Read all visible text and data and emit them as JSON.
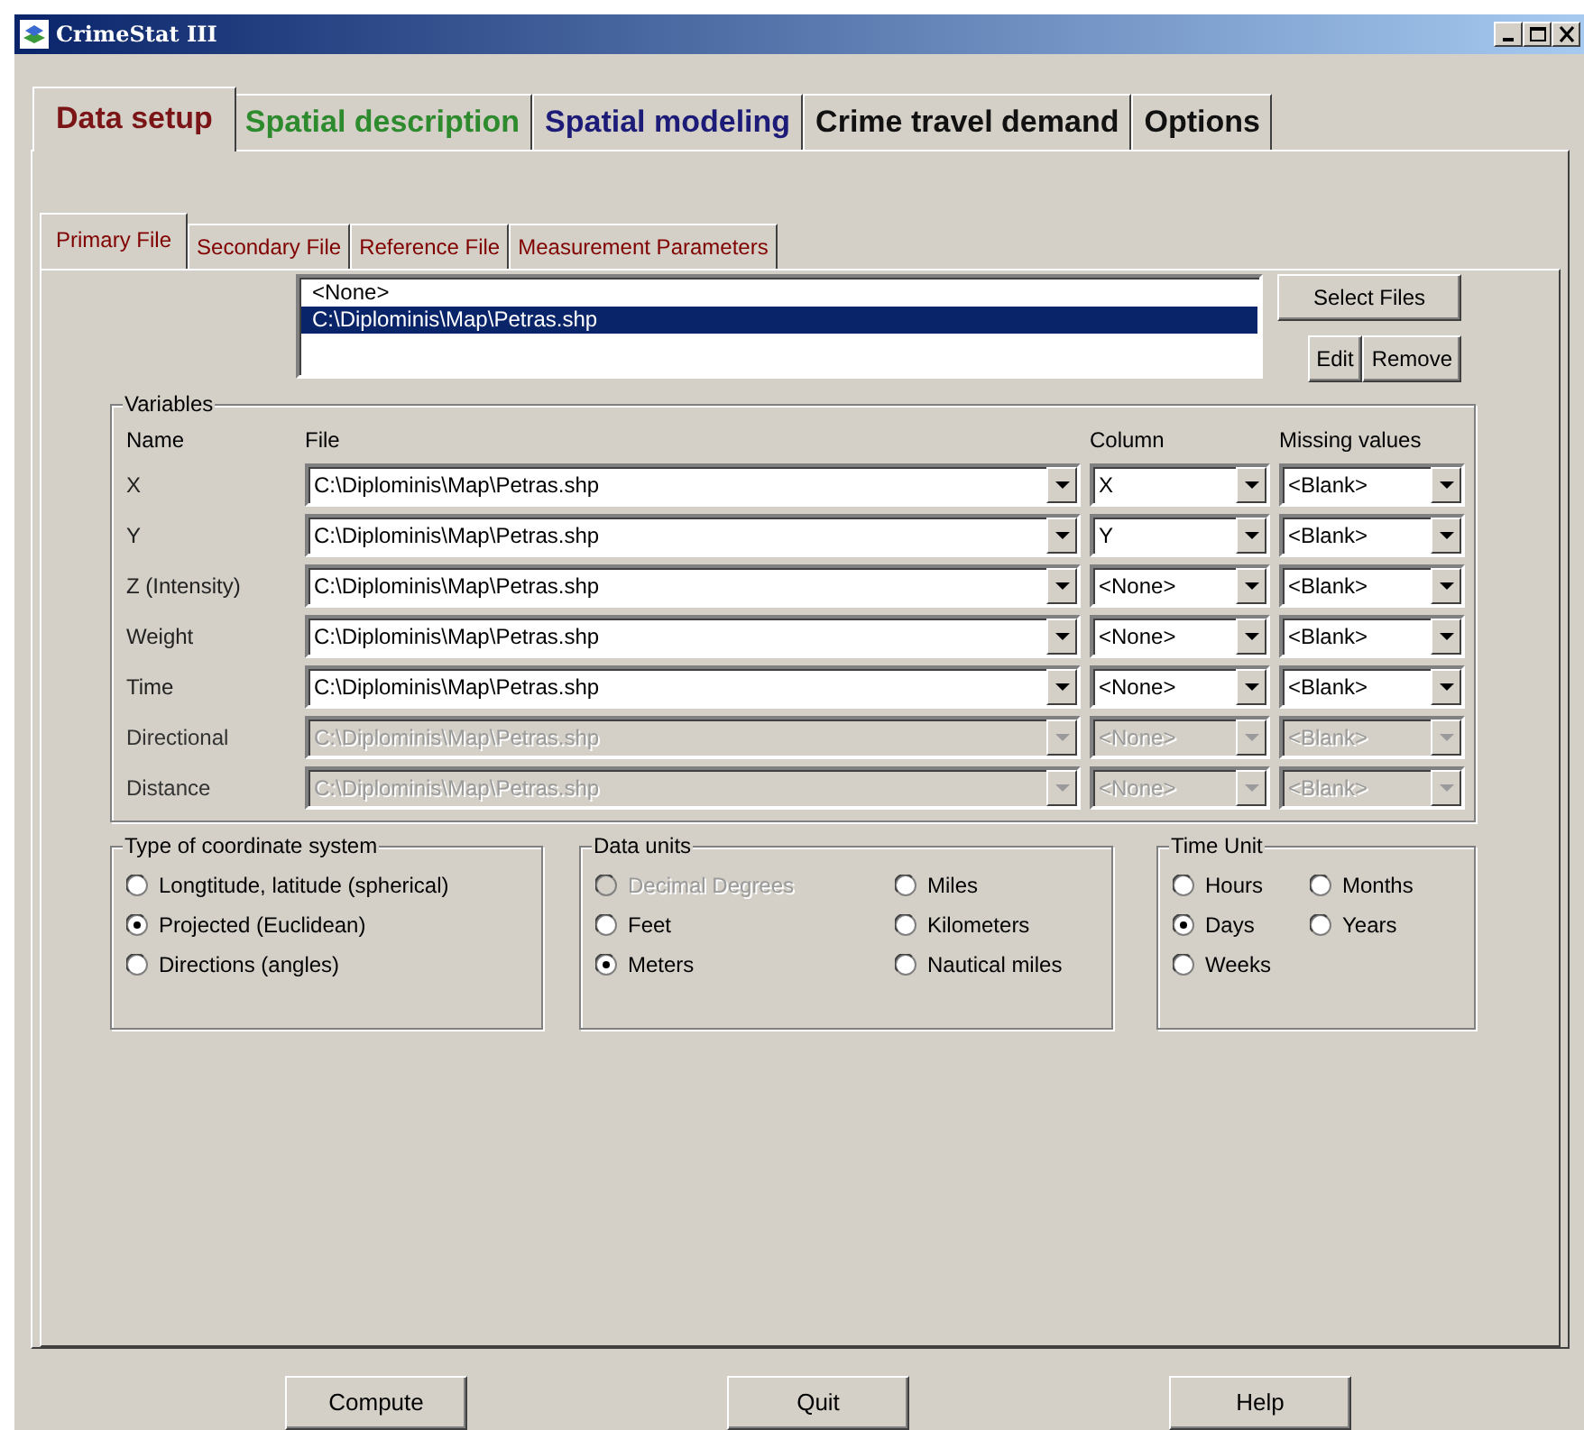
{
  "window": {
    "title": "CrimeStat III"
  },
  "main_tabs": [
    {
      "label": "Data setup",
      "selected": true,
      "color": "#7a1416"
    },
    {
      "label": "Spatial description",
      "selected": false,
      "color": "#2d8a2d"
    },
    {
      "label": "Spatial modeling",
      "selected": false,
      "color": "#1c1c78"
    },
    {
      "label": "Crime travel demand",
      "selected": false,
      "color": "#111111"
    },
    {
      "label": "Options",
      "selected": false,
      "color": "#111111"
    }
  ],
  "sub_tabs": [
    {
      "label": "Primary File",
      "selected": true
    },
    {
      "label": "Secondary File",
      "selected": false
    },
    {
      "label": "Reference File",
      "selected": false
    },
    {
      "label": "Measurement Parameters",
      "selected": false
    }
  ],
  "files": {
    "items": [
      {
        "text": "<None>",
        "selected": false
      },
      {
        "text": "C:\\Diplominis\\Map\\Petras.shp",
        "selected": true
      }
    ],
    "select_button": "Select Files",
    "edit_button": "Edit",
    "remove_button": "Remove"
  },
  "variables": {
    "title": "Variables",
    "headers": [
      "Name",
      "File",
      "Column",
      "Missing values"
    ],
    "rows": [
      {
        "name": "X",
        "file": "C:\\Diplominis\\Map\\Petras.shp",
        "column": "X",
        "missing": "<Blank>",
        "disabled": false
      },
      {
        "name": "Y",
        "file": "C:\\Diplominis\\Map\\Petras.shp",
        "column": "Y",
        "missing": "<Blank>",
        "disabled": false
      },
      {
        "name": "Z (Intensity)",
        "file": "C:\\Diplominis\\Map\\Petras.shp",
        "column": "<None>",
        "missing": "<Blank>",
        "disabled": false
      },
      {
        "name": "Weight",
        "file": "C:\\Diplominis\\Map\\Petras.shp",
        "column": "<None>",
        "missing": "<Blank>",
        "disabled": false
      },
      {
        "name": "Time",
        "file": "C:\\Diplominis\\Map\\Petras.shp",
        "column": "<None>",
        "missing": "<Blank>",
        "disabled": false
      },
      {
        "name": "Directional",
        "file": "C:\\Diplominis\\Map\\Petras.shp",
        "column": "<None>",
        "missing": "<Blank>",
        "disabled": true
      },
      {
        "name": "Distance",
        "file": "C:\\Diplominis\\Map\\Petras.shp",
        "column": "<None>",
        "missing": "<Blank>",
        "disabled": true
      }
    ]
  },
  "coordinate_system": {
    "title": "Type of coordinate system",
    "options": [
      {
        "label": "Longtitude, latitude (spherical)",
        "selected": false,
        "disabled": false
      },
      {
        "label": "Projected (Euclidean)",
        "selected": true,
        "disabled": false
      },
      {
        "label": "Directions (angles)",
        "selected": false,
        "disabled": false
      }
    ]
  },
  "data_units": {
    "title": "Data units",
    "options": [
      {
        "label": "Decimal Degrees",
        "selected": false,
        "disabled": true
      },
      {
        "label": "Miles",
        "selected": false,
        "disabled": false
      },
      {
        "label": "Feet",
        "selected": false,
        "disabled": false
      },
      {
        "label": "Kilometers",
        "selected": false,
        "disabled": false
      },
      {
        "label": "Meters",
        "selected": true,
        "disabled": false
      },
      {
        "label": "Nautical miles",
        "selected": false,
        "disabled": false
      }
    ]
  },
  "time_unit": {
    "title": "Time Unit",
    "options": [
      {
        "label": "Hours",
        "selected": false,
        "disabled": false
      },
      {
        "label": "Months",
        "selected": false,
        "disabled": false
      },
      {
        "label": "Days",
        "selected": true,
        "disabled": false
      },
      {
        "label": "Years",
        "selected": false,
        "disabled": false
      },
      {
        "label": "Weeks",
        "selected": false,
        "disabled": false
      }
    ]
  },
  "buttons": [
    "Compute",
    "Quit",
    "Help"
  ]
}
